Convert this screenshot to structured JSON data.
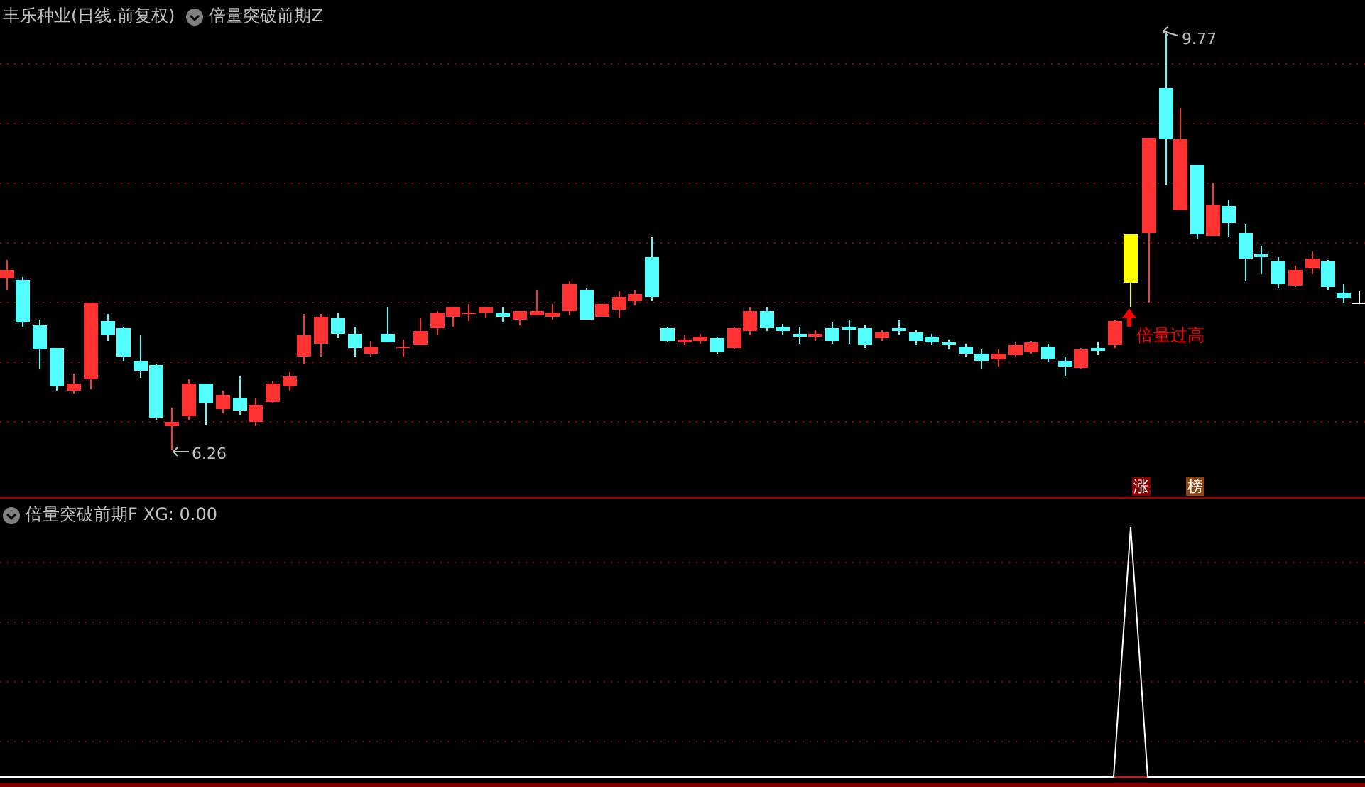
{
  "header": {
    "title": "丰乐种业(日线.前复权)",
    "indicator": "倍量突破前期Z"
  },
  "price_chart": {
    "high_label": "9.77",
    "low_label": "6.26",
    "signal_label": "倍量过高",
    "badges": [
      {
        "text": "涨",
        "kind": "limit"
      },
      {
        "text": "榜",
        "kind": "list"
      }
    ]
  },
  "indicator_panel": {
    "title": "倍量突破前期F",
    "reading": "XG: 0.00"
  }
}
